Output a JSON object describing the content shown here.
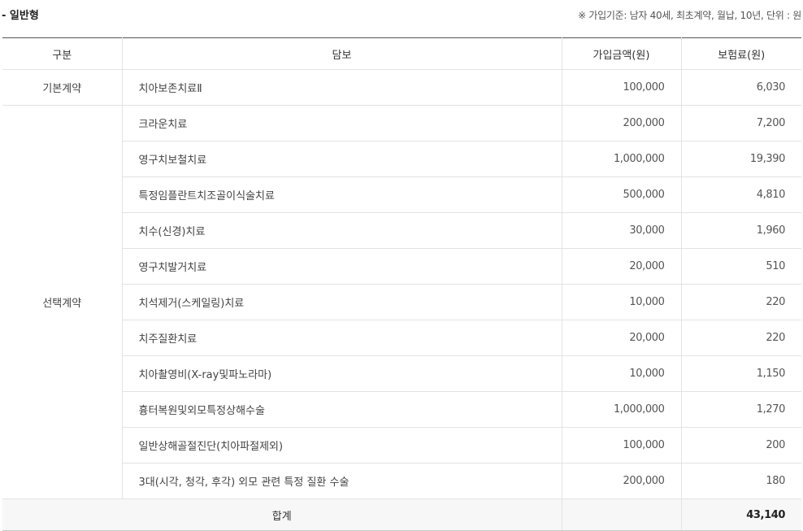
{
  "title": "- 일반형",
  "note": "※  가입기준: 남자 40세, 최초계약, 월납, 10년, 단위 : 원",
  "headers": {
    "category": "구분",
    "coverage": "담보",
    "amount": "가입금액(원)",
    "premium": "보험료(원)"
  },
  "basic": {
    "category": "기본계약",
    "name": "치아보존치료Ⅱ",
    "amount": "100,000",
    "premium": "6,030"
  },
  "optional_category": "선택계약",
  "rows": [
    {
      "name": "크라운치료",
      "amount": "200,000",
      "premium": "7,200"
    },
    {
      "name": "영구치보철치료",
      "amount": "1,000,000",
      "premium": "19,390"
    },
    {
      "name": "특정임플란트치조골이식술치료",
      "amount": "500,000",
      "premium": "4,810"
    },
    {
      "name": "치수(신경)치료",
      "amount": "30,000",
      "premium": "1,960"
    },
    {
      "name": "영구치발거치료",
      "amount": "20,000",
      "premium": "510"
    },
    {
      "name": "치석제거(스케일링)치료",
      "amount": "10,000",
      "premium": "220"
    },
    {
      "name": "치주질환치료",
      "amount": "20,000",
      "premium": "220"
    },
    {
      "name": "치아촬영비(X-ray및파노라마)",
      "amount": "10,000",
      "premium": "1,150"
    },
    {
      "name": "흉터복원및외모특정상해수술",
      "amount": "1,000,000",
      "premium": "1,270"
    },
    {
      "name": "일반상해골절진단(치아파절제외)",
      "amount": "100,000",
      "premium": "200"
    },
    {
      "name": "3대(시각, 청각, 후각) 외모 관련 특정 질환 수술",
      "amount": "200,000",
      "premium": "180"
    }
  ],
  "total": {
    "label": "합계",
    "premium": "43,140"
  }
}
